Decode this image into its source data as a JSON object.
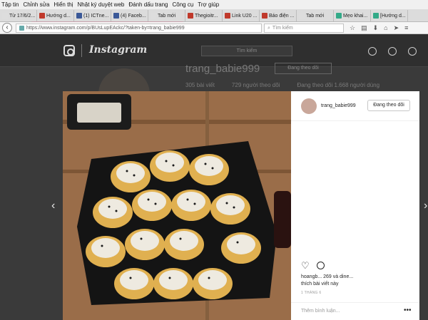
{
  "menubar": [
    "Tập tin",
    "Chỉnh sửa",
    "Hiển thị",
    "Nhật ký duyệt web",
    "Đánh dấu trang",
    "Công cụ",
    "Trợ giúp"
  ],
  "tabs": [
    {
      "label": "Từ 17/6/2...",
      "color": "#ddd",
      "active": false
    },
    {
      "label": "Hướng d...",
      "color": "#c0392b",
      "active": false
    },
    {
      "label": "(1) ICTne...",
      "color": "#3b5998",
      "active": false
    },
    {
      "label": "(4) Faceb...",
      "color": "#3b5998",
      "active": false
    },
    {
      "label": "Tab mới",
      "color": "#ddd",
      "active": false
    },
    {
      "label": "Thegioitr...",
      "color": "#c0392b",
      "active": false
    },
    {
      "label": "Link U20 ...",
      "color": "#c0392b",
      "active": false
    },
    {
      "label": "Báo điện ...",
      "color": "#c0392b",
      "active": false
    },
    {
      "label": "Tab mới",
      "color": "#ddd",
      "active": false
    },
    {
      "label": "Mẹo khai...",
      "color": "#3a8",
      "active": false
    },
    {
      "label": "[Hướng d...",
      "color": "#3a8",
      "active": false
    }
  ],
  "navbar": {
    "url": "https://www.instagram.com/p/BUsLupEAckc/?taken-by=trang_babie999",
    "search_placeholder": "Tìm kiếm"
  },
  "instagram": {
    "wordmark": "Instagram",
    "search_placeholder": "Tìm kiếm"
  },
  "profile": {
    "username": "trang_babie999",
    "follow_label": "Đang theo dõi",
    "stats": [
      "305 bài viết",
      "729 người theo dõi",
      "Đang theo dõi 1.668 người dùng"
    ]
  },
  "post": {
    "username": "trang_babie999",
    "follow_label": "Đang theo dõi",
    "likes_line1": "hoangb... 269 và dine...",
    "likes_line2": "thích bài viết này",
    "time": "1 THÁNG 6",
    "comment_placeholder": "Thêm bình luận...",
    "more": "•••"
  }
}
